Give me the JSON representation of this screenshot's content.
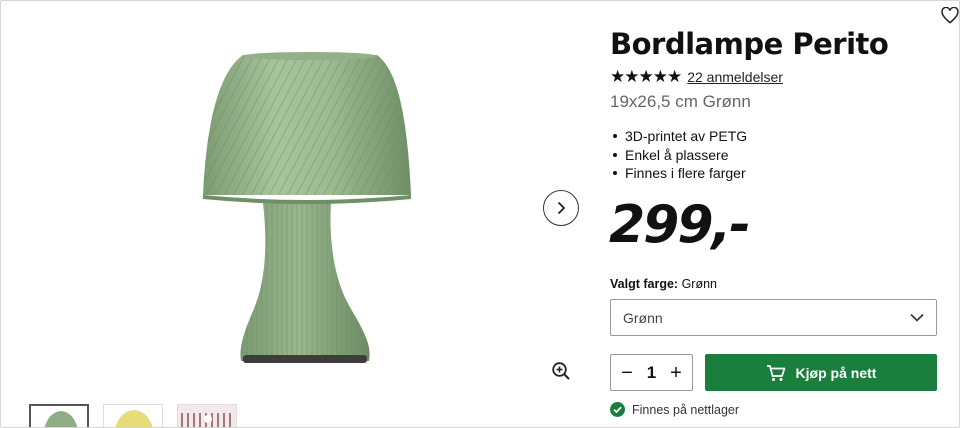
{
  "product": {
    "title": "Bordlampe Perito",
    "stars": "★★★★★",
    "reviews_label": "22 anmeldelser",
    "subtitle": "19x26,5 cm Grønn",
    "features": [
      "3D-printet av PETG",
      "Enkel å plassere",
      "Finnes i flere farger"
    ],
    "price": "299,-"
  },
  "color_picker": {
    "label": "Valgt farge:",
    "selected": "Grønn"
  },
  "purchase": {
    "quantity": "1",
    "minus": "−",
    "plus": "+",
    "buy_label": "Kjøp på nett"
  },
  "stock": {
    "text": "Finnes på nettlager"
  },
  "gallery": {
    "thumbnails": [
      "green-lamp",
      "yellow-lamp",
      "pink-lamp"
    ]
  },
  "colors": {
    "accent_green": "#1a7f3c",
    "lamp_green": "#8fae86"
  }
}
